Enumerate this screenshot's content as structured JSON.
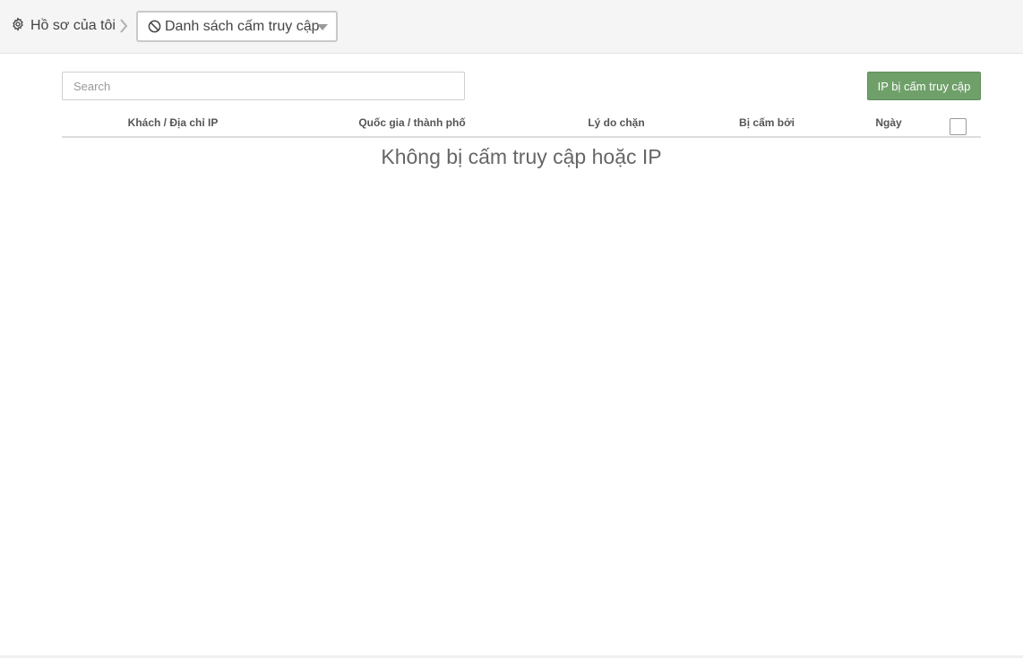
{
  "breadcrumb": {
    "home_label": "Hồ sơ của tôi",
    "current_label": "Danh sách cấm truy cập"
  },
  "toolbar": {
    "search_placeholder": "Search",
    "add_button_label": "IP bị cấm truy cập"
  },
  "table": {
    "columns": [
      "Khách / Địa chỉ IP",
      "Quốc gia / thành phố",
      "Lý do chặn",
      "Bị cấm bởi",
      "Ngày"
    ],
    "rows": [],
    "empty_message": "Không bị cấm truy cập hoặc IP"
  },
  "colors": {
    "accent": "#6fa06a",
    "topbar_bg": "#f5f5f6"
  },
  "icons": {
    "home": "gear-icon",
    "separator": "chevron-right-icon",
    "current": "ban-icon",
    "dropdown": "caret-down-icon"
  }
}
